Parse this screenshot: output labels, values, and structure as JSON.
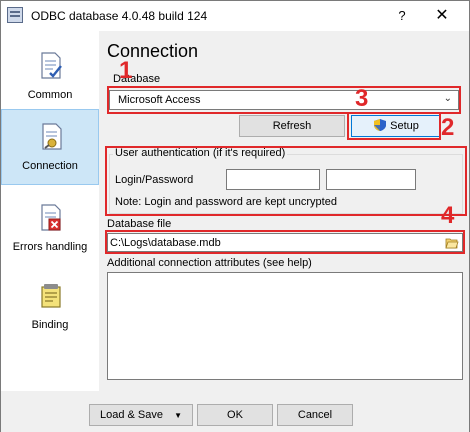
{
  "window": {
    "title": "ODBC database 4.0.48 build 124",
    "help": "?",
    "close": "✕"
  },
  "sidebar": {
    "items": [
      {
        "label": "Common"
      },
      {
        "label": "Connection"
      },
      {
        "label": "Errors handling"
      },
      {
        "label": "Binding"
      }
    ]
  },
  "main": {
    "title": "Connection",
    "database_label": "Database",
    "database_value": "Microsoft Access",
    "refresh_label": "Refresh",
    "setup_label": "Setup",
    "auth_group_title": "User authentication (if it's required)",
    "login_label": "Login/Password",
    "login_value": "",
    "password_value": "",
    "auth_note": "Note: Login and password are kept uncrypted",
    "db_file_label": "Database file",
    "db_file_value": "C:\\Logs\\database.mdb",
    "attrs_label": "Additional connection attributes (see help)",
    "attrs_value": ""
  },
  "annotations": [
    "1",
    "2",
    "3",
    "4"
  ],
  "footer": {
    "load_save_label": "Load & Save",
    "ok_label": "OK",
    "cancel_label": "Cancel"
  },
  "colors": {
    "annotation": "#e0282a",
    "selected_bg": "#cde6f7"
  }
}
